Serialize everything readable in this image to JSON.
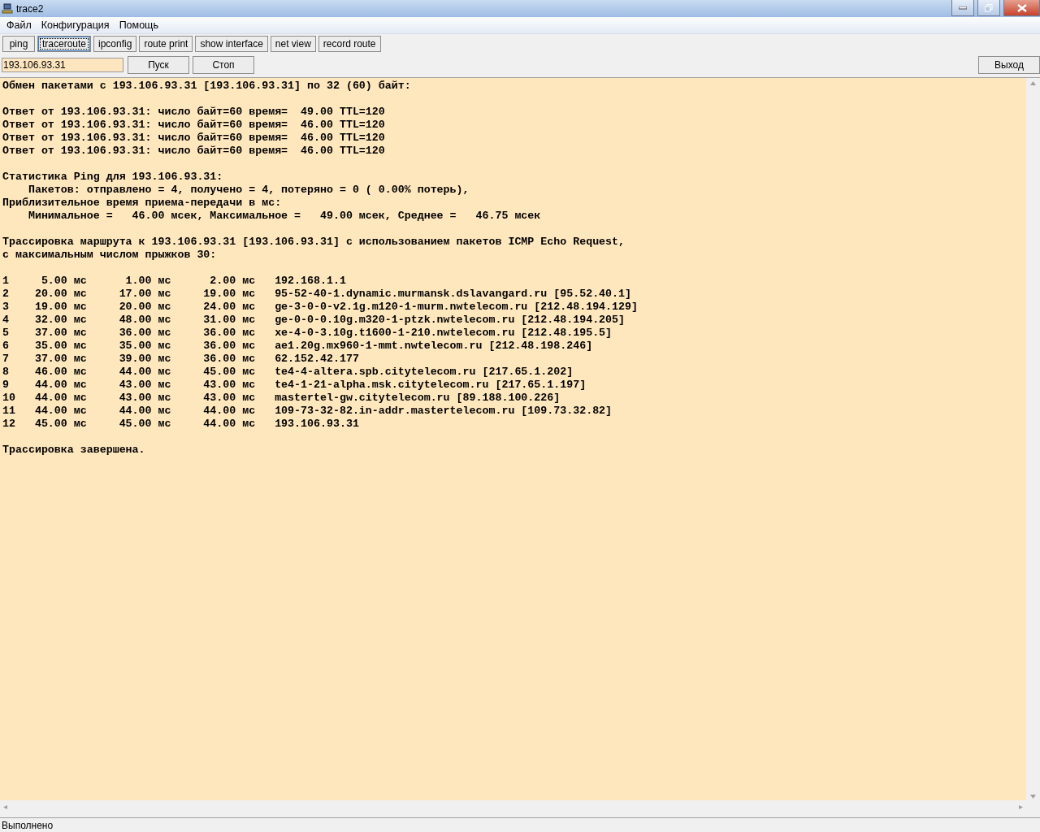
{
  "window": {
    "title": "trace2"
  },
  "menu": [
    "Файл",
    "Конфигурация",
    "Помощь"
  ],
  "tools": [
    {
      "label": "ping",
      "selected": false
    },
    {
      "label": "traceroute",
      "selected": true
    },
    {
      "label": "ipconfig",
      "selected": false
    },
    {
      "label": "route print",
      "selected": false
    },
    {
      "label": "show interface",
      "selected": false
    },
    {
      "label": "net view",
      "selected": false
    },
    {
      "label": "record route",
      "selected": false
    }
  ],
  "host_field": {
    "value": "193.106.93.31"
  },
  "buttons": {
    "start": "Пуск",
    "stop": "Стоп",
    "exit": "Выход"
  },
  "output": [
    [
      "Обмен пакетами с 193.106.93.31 [193.106.93.31] по 32 (60) байт:"
    ],
    [
      "Ответ от 193.106.93.31: число байт=60 время=  49.00 TTL=120",
      "Ответ от 193.106.93.31: число байт=60 время=  46.00 TTL=120",
      "Ответ от 193.106.93.31: число байт=60 время=  46.00 TTL=120",
      "Ответ от 193.106.93.31: число байт=60 время=  46.00 TTL=120"
    ],
    [
      "Статистика Ping для 193.106.93.31:",
      "    Пакетов: отправлено = 4, получено = 4, потеряно = 0 ( 0.00% потерь),",
      "Приблизительное время приема-передачи в мс:",
      "    Минимальное =   46.00 мсек, Максимальное =   49.00 мсек, Среднее =   46.75 мсек"
    ],
    [
      "Трассировка маршрута к 193.106.93.31 [193.106.93.31] с использованием пакетов ICMP Echo Request,",
      "с максимальным числом прыжков 30:"
    ],
    [
      "1     5.00 мс      1.00 мс      2.00 мс   192.168.1.1",
      "2    20.00 мс     17.00 мс     19.00 мс   95-52-40-1.dynamic.murmansk.dslavangard.ru [95.52.40.1]",
      "3    19.00 мс     20.00 мс     24.00 мс   ge-3-0-0-v2.1g.m120-1-murm.nwtelecom.ru [212.48.194.129]",
      "4    32.00 мс     48.00 мс     31.00 мс   ge-0-0-0.10g.m320-1-ptzk.nwtelecom.ru [212.48.194.205]",
      "5    37.00 мс     36.00 мс     36.00 мс   xe-4-0-3.10g.t1600-1-210.nwtelecom.ru [212.48.195.5]",
      "6    35.00 мс     35.00 мс     36.00 мс   ae1.20g.mx960-1-mmt.nwtelecom.ru [212.48.198.246]",
      "7    37.00 мс     39.00 мс     36.00 мс   62.152.42.177",
      "8    46.00 мс     44.00 мс     45.00 мс   te4-4-altera.spb.citytelecom.ru [217.65.1.202]",
      "9    44.00 мс     43.00 мс     43.00 мс   te4-1-21-alpha.msk.citytelecom.ru [217.65.1.197]",
      "10   44.00 мс     43.00 мс     43.00 мс   mastertel-gw.citytelecom.ru [89.188.100.226]",
      "11   44.00 мс     44.00 мс     44.00 мс   109-73-32-82.in-addr.mastertelecom.ru [109.73.32.82]",
      "12   45.00 мс     45.00 мс     44.00 мс   193.106.93.31"
    ],
    [
      "Трассировка завершена."
    ]
  ],
  "status_bar": "Выполнено"
}
